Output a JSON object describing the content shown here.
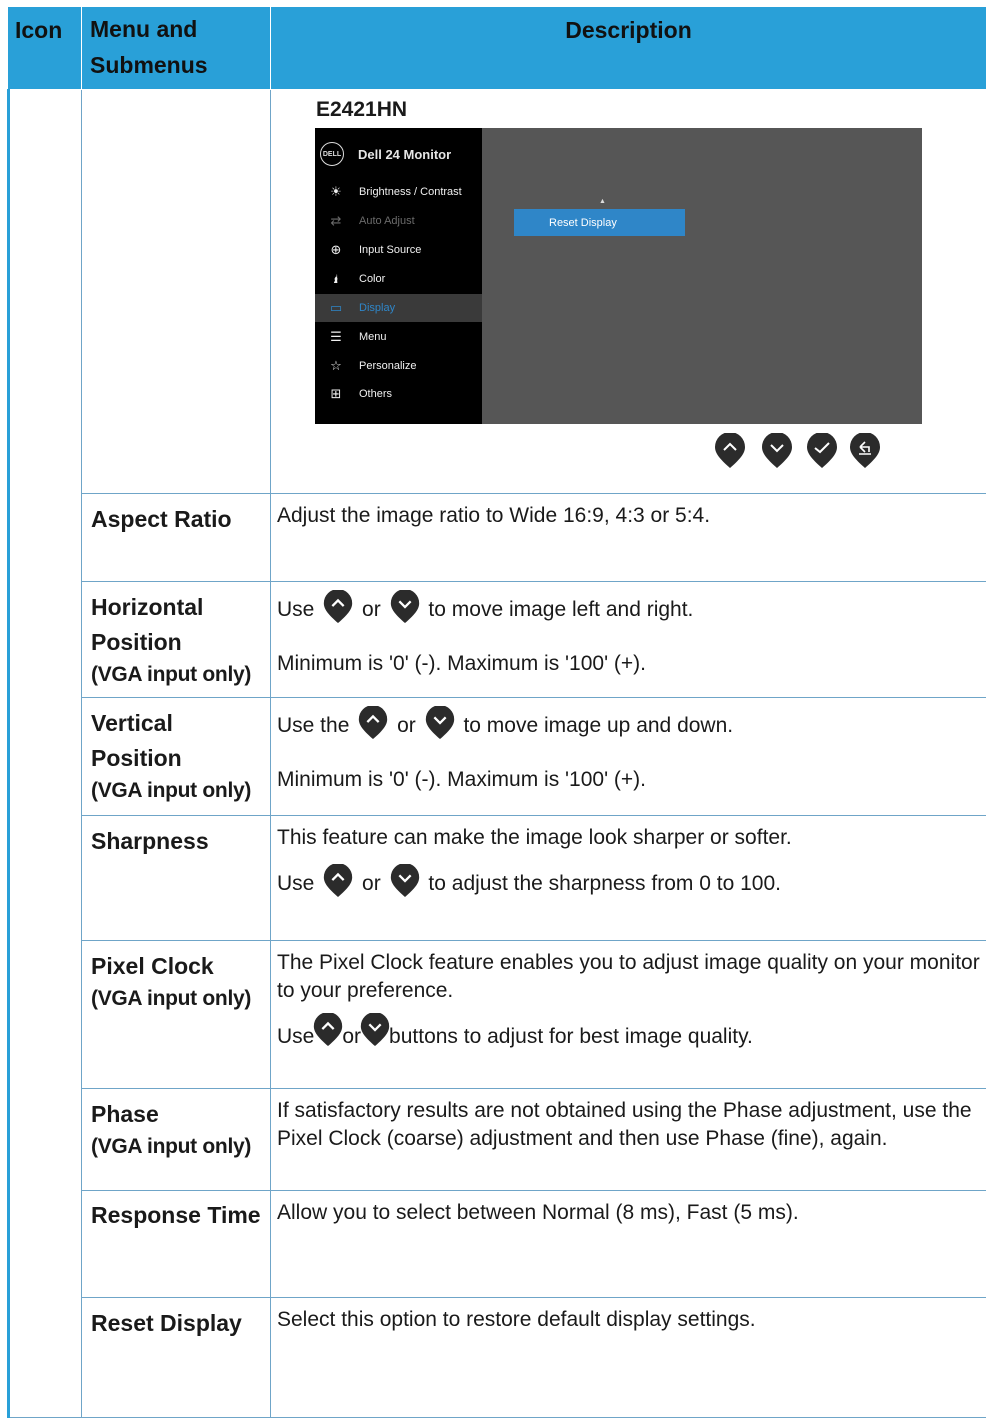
{
  "header": {
    "icon": "Icon",
    "menu_line1": "Menu and",
    "menu_line2": "Submenus",
    "description": "Description"
  },
  "osd": {
    "model": "E2421HN",
    "logo_text": "DELL",
    "monitor_title": "Dell 24 Monitor",
    "items": [
      {
        "label": "Brightness / Contrast",
        "icon": "brightness-icon",
        "state": "normal"
      },
      {
        "label": "Auto Adjust",
        "icon": "auto-adjust-icon",
        "state": "disabled"
      },
      {
        "label": "Input Source",
        "icon": "input-source-icon",
        "state": "normal"
      },
      {
        "label": "Color",
        "icon": "color-icon",
        "state": "normal"
      },
      {
        "label": "Display",
        "icon": "display-icon",
        "state": "selected"
      },
      {
        "label": "Menu",
        "icon": "menu-icon",
        "state": "normal"
      },
      {
        "label": "Personalize",
        "icon": "personalize-icon",
        "state": "normal"
      },
      {
        "label": "Others",
        "icon": "others-icon",
        "state": "normal"
      }
    ],
    "submenu_item": "Reset Display",
    "buttons": [
      "up-button",
      "down-button",
      "confirm-button",
      "back-button"
    ],
    "colors": {
      "screen": "#565656",
      "sidebar": "#000000",
      "accent": "#2f86c8"
    }
  },
  "rows": [
    {
      "title": "Aspect Ratio",
      "note": "",
      "desc": "Adjust the image ratio to Wide 16:9, 4:3 or 5:4."
    },
    {
      "title": "Horizontal Position",
      "note": "(VGA input only)",
      "p1a": "Use",
      "or": "or",
      "p1b": "to move image left and right.",
      "p2": "Minimum is '0' (-). Maximum is '100' (+)."
    },
    {
      "title": "Vertical Position",
      "note": "(VGA input only)",
      "p1a": "Use the",
      "or": "or",
      "p1b": "to move image up and down.",
      "p2": "Minimum is '0' (-). Maximum is '100' (+)."
    },
    {
      "title": "Sharpness",
      "note": "",
      "p1": "This feature can make the image look sharper or softer.",
      "p2a": "Use",
      "or": "or",
      "p2b": "to adjust the sharpness from 0 to 100."
    },
    {
      "title": "Pixel Clock",
      "note": "(VGA input only)",
      "p1": "The Pixel Clock feature enables you to adjust image quality on your monitor to your preference.",
      "p2a": "Use",
      "or": "or",
      "p2b": "buttons to adjust for best image quality."
    },
    {
      "title": "Phase",
      "note": "(VGA input only)",
      "desc": "If satisfactory results are not obtained using the Phase adjustment, use the Pixel Clock (coarse) adjustment and then use Phase (fine), again."
    },
    {
      "title": "Response Time",
      "note": "",
      "desc": "Allow you to select between Normal (8 ms), Fast (5 ms)."
    },
    {
      "title": "Reset Display",
      "note": "",
      "desc": "Select this option to restore default display settings."
    }
  ],
  "colors": {
    "header_bg": "#29a0d8",
    "border": "#6fa5c8",
    "button_fill": "#2b2b2b"
  }
}
